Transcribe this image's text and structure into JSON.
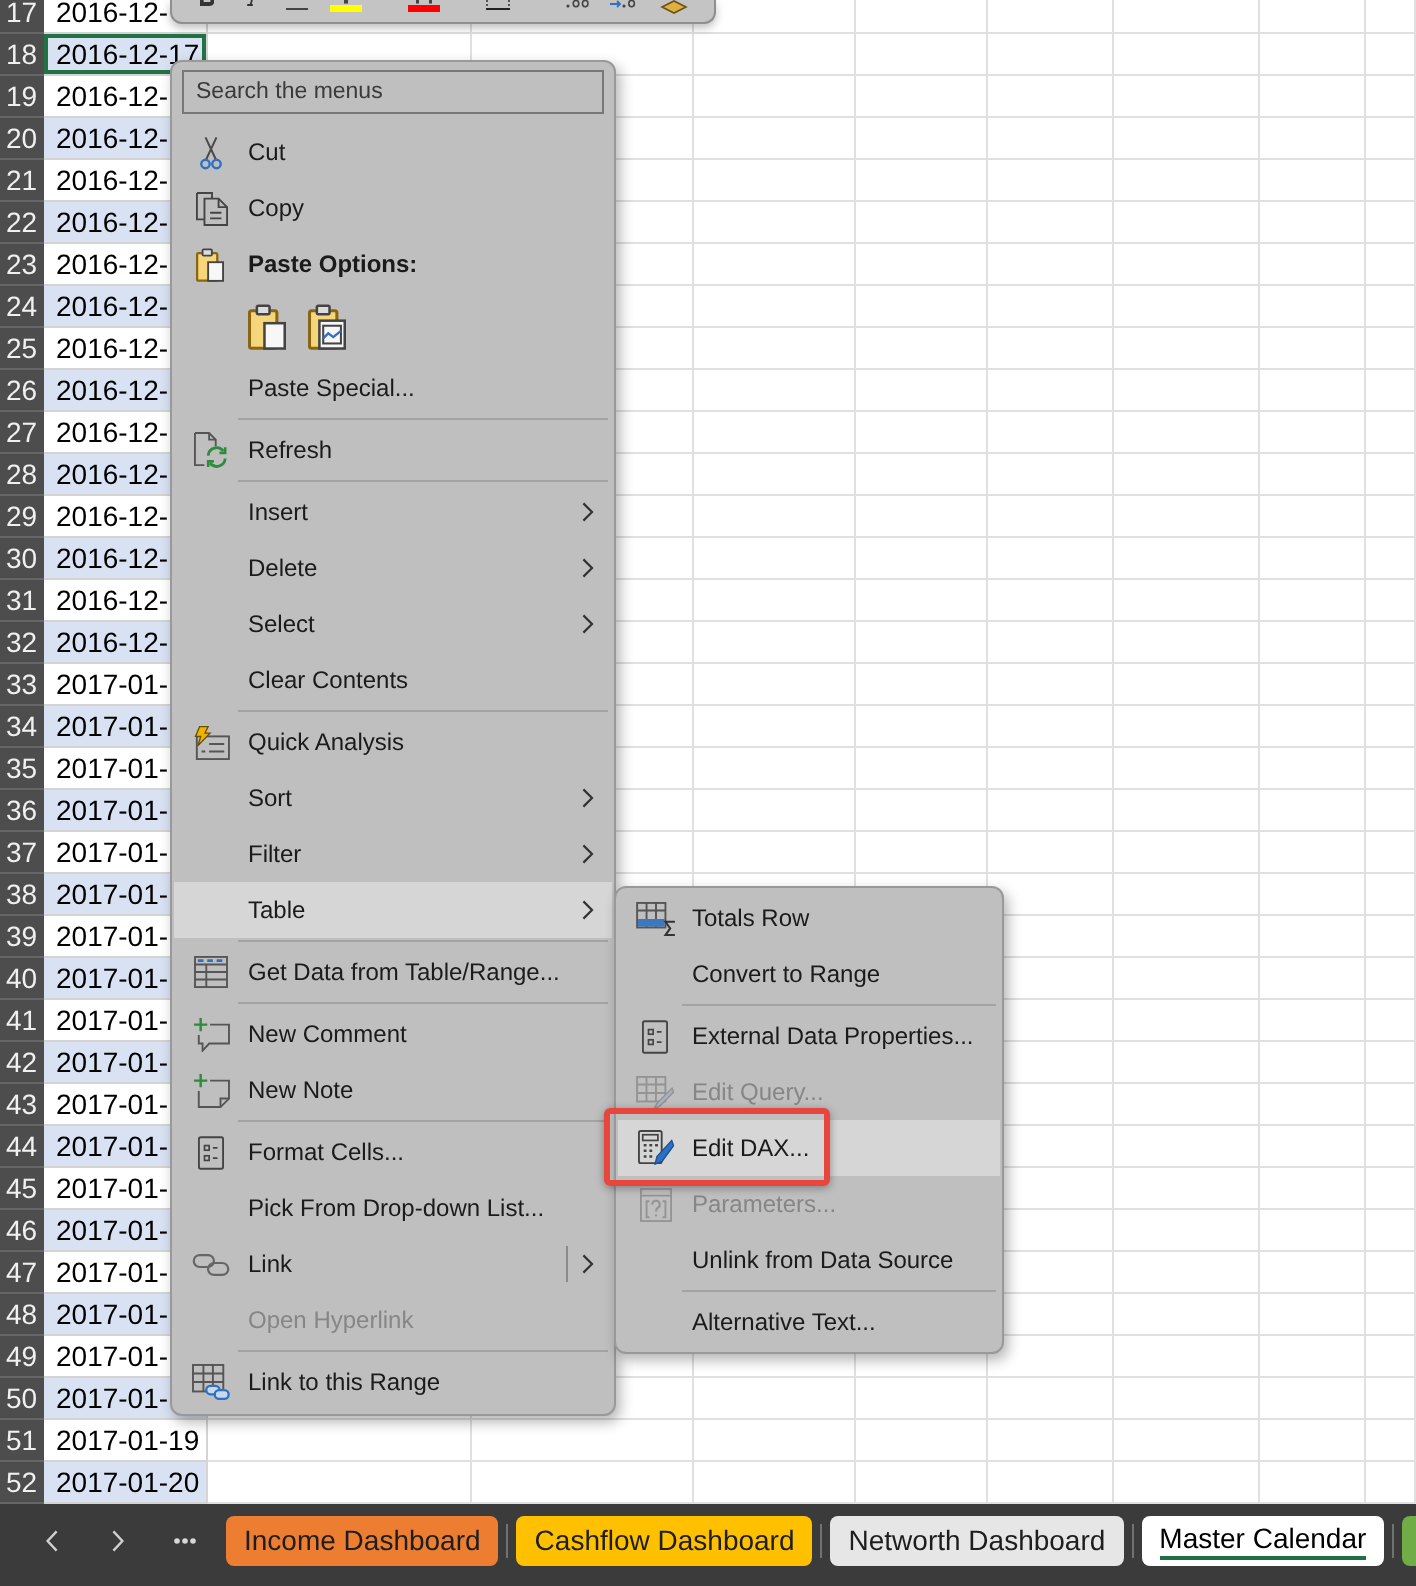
{
  "sheet": {
    "rows": [
      {
        "number": "17",
        "value": "2016-12-",
        "selected": false
      },
      {
        "number": "18",
        "value": "2016-12-17",
        "selected": true
      },
      {
        "number": "19",
        "value": "2016-12-",
        "selected": false
      },
      {
        "number": "20",
        "value": "2016-12-",
        "selected": false
      },
      {
        "number": "21",
        "value": "2016-12-",
        "selected": false
      },
      {
        "number": "22",
        "value": "2016-12-",
        "selected": false
      },
      {
        "number": "23",
        "value": "2016-12-",
        "selected": false
      },
      {
        "number": "24",
        "value": "2016-12-",
        "selected": false
      },
      {
        "number": "25",
        "value": "2016-12-",
        "selected": false
      },
      {
        "number": "26",
        "value": "2016-12-",
        "selected": false
      },
      {
        "number": "27",
        "value": "2016-12-",
        "selected": false
      },
      {
        "number": "28",
        "value": "2016-12-",
        "selected": false
      },
      {
        "number": "29",
        "value": "2016-12-",
        "selected": false
      },
      {
        "number": "30",
        "value": "2016-12-",
        "selected": false
      },
      {
        "number": "31",
        "value": "2016-12-",
        "selected": false
      },
      {
        "number": "32",
        "value": "2016-12-",
        "selected": false
      },
      {
        "number": "33",
        "value": "2017-01-",
        "selected": false
      },
      {
        "number": "34",
        "value": "2017-01-",
        "selected": false
      },
      {
        "number": "35",
        "value": "2017-01-",
        "selected": false
      },
      {
        "number": "36",
        "value": "2017-01-",
        "selected": false
      },
      {
        "number": "37",
        "value": "2017-01-",
        "selected": false
      },
      {
        "number": "38",
        "value": "2017-01-",
        "selected": false
      },
      {
        "number": "39",
        "value": "2017-01-",
        "selected": false
      },
      {
        "number": "40",
        "value": "2017-01-",
        "selected": false
      },
      {
        "number": "41",
        "value": "2017-01-",
        "selected": false
      },
      {
        "number": "42",
        "value": "2017-01-",
        "selected": false
      },
      {
        "number": "43",
        "value": "2017-01-",
        "selected": false
      },
      {
        "number": "44",
        "value": "2017-01-",
        "selected": false
      },
      {
        "number": "45",
        "value": "2017-01-",
        "selected": false
      },
      {
        "number": "46",
        "value": "2017-01-",
        "selected": false
      },
      {
        "number": "47",
        "value": "2017-01-",
        "selected": false
      },
      {
        "number": "48",
        "value": "2017-01-",
        "selected": false
      },
      {
        "number": "49",
        "value": "2017-01-",
        "selected": false
      },
      {
        "number": "50",
        "value": "2017-01-",
        "selected": false
      },
      {
        "number": "51",
        "value": "2017-01-19",
        "selected": false
      },
      {
        "number": "52",
        "value": "2017-01-20",
        "selected": false
      }
    ]
  },
  "context_menu": {
    "search": {
      "placeholder": "Search the menus"
    },
    "sections": [
      {
        "items": [
          {
            "label": "Cut",
            "kind": "command",
            "disabled": false,
            "highlighted": false
          },
          {
            "label": "Copy",
            "kind": "command",
            "disabled": false,
            "highlighted": false
          },
          {
            "label": "Paste Options:",
            "kind": "heading"
          },
          {
            "kind": "paste_buttons"
          },
          {
            "label": "Paste Special...",
            "kind": "command",
            "disabled": false,
            "highlighted": false
          }
        ]
      },
      {
        "items": [
          {
            "label": "Refresh",
            "kind": "command",
            "disabled": false,
            "highlighted": false
          }
        ]
      },
      {
        "items": [
          {
            "label": "Insert",
            "kind": "submenu",
            "disabled": false,
            "highlighted": false
          },
          {
            "label": "Delete",
            "kind": "submenu",
            "disabled": false,
            "highlighted": false
          },
          {
            "label": "Select",
            "kind": "submenu",
            "disabled": false,
            "highlighted": false
          },
          {
            "label": "Clear Contents",
            "kind": "command",
            "disabled": false,
            "highlighted": false
          }
        ]
      },
      {
        "items": [
          {
            "label": "Quick Analysis",
            "kind": "command",
            "disabled": false,
            "highlighted": false
          },
          {
            "label": "Sort",
            "kind": "submenu",
            "disabled": false,
            "highlighted": false
          },
          {
            "label": "Filter",
            "kind": "submenu",
            "disabled": false,
            "highlighted": false
          },
          {
            "label": "Table",
            "kind": "submenu",
            "disabled": false,
            "highlighted": true
          }
        ]
      },
      {
        "items": [
          {
            "label": "Get Data from Table/Range...",
            "kind": "command",
            "disabled": false,
            "highlighted": false
          }
        ]
      },
      {
        "items": [
          {
            "label": "New Comment",
            "kind": "command",
            "disabled": false,
            "highlighted": false
          },
          {
            "label": "New Note",
            "kind": "command",
            "disabled": false,
            "highlighted": false
          }
        ]
      },
      {
        "items": [
          {
            "label": "Format Cells...",
            "kind": "command",
            "disabled": false,
            "highlighted": false
          },
          {
            "label": "Pick From Drop-down List...",
            "kind": "command",
            "disabled": false,
            "highlighted": false
          },
          {
            "label": "Link",
            "kind": "split_submenu",
            "disabled": false,
            "highlighted": false
          },
          {
            "label": "Open Hyperlink",
            "kind": "command",
            "disabled": true,
            "highlighted": false
          }
        ]
      },
      {
        "items": [
          {
            "label": "Link to this Range",
            "kind": "command",
            "disabled": false,
            "highlighted": false
          }
        ]
      }
    ]
  },
  "table_submenu": {
    "sections": [
      {
        "items": [
          {
            "label": "Totals Row",
            "kind": "command",
            "disabled": false,
            "highlighted": false,
            "outlined": false
          },
          {
            "label": "Convert to Range",
            "kind": "command",
            "disabled": false,
            "highlighted": false,
            "outlined": false
          }
        ]
      },
      {
        "items": [
          {
            "label": "External Data Properties...",
            "kind": "command",
            "disabled": false,
            "highlighted": false,
            "outlined": false
          },
          {
            "label": "Edit Query...",
            "kind": "command",
            "disabled": true,
            "highlighted": false,
            "outlined": false
          },
          {
            "label": "Edit DAX...",
            "kind": "command",
            "disabled": false,
            "highlighted": true,
            "outlined": true
          },
          {
            "label": "Parameters...",
            "kind": "command",
            "disabled": true,
            "highlighted": false,
            "outlined": false
          },
          {
            "label": "Unlink from Data Source",
            "kind": "command",
            "disabled": false,
            "highlighted": false,
            "outlined": false
          }
        ]
      },
      {
        "items": [
          {
            "label": "Alternative Text...",
            "kind": "command",
            "disabled": false,
            "highlighted": false,
            "outlined": false
          }
        ]
      }
    ]
  },
  "sheet_tabs": [
    {
      "label": "Income Dashboard",
      "color": "#ed7d31",
      "selected": false
    },
    {
      "label": "Cashflow Dashboard",
      "color": "#ffc000",
      "selected": false
    },
    {
      "label": "Networth Dashboard",
      "color": "#e7e6e6",
      "selected": false
    },
    {
      "label": "Master Calendar",
      "selected": true
    },
    {
      "color": "#70ad47",
      "selected": false
    }
  ]
}
